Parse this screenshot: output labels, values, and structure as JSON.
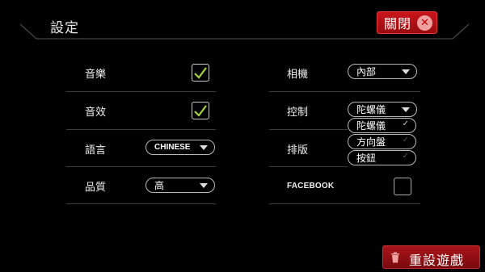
{
  "header": {
    "title": "設定",
    "close_label": "關閉"
  },
  "left": {
    "music_label": "音樂",
    "sfx_label": "音效",
    "language_label": "語言",
    "language_value": "CHINESE",
    "quality_label": "品質",
    "quality_value": "高"
  },
  "right": {
    "camera_label": "相機",
    "camera_value": "內部",
    "control_label": "控制",
    "control_value": "陀螺儀",
    "control_options": [
      "陀螺儀",
      "方向盤",
      "按鈕"
    ],
    "layout_label": "排版",
    "facebook_label": "FACEBOOK"
  },
  "footer": {
    "reset_label": "重設遊戲"
  },
  "colors": {
    "accent_red": "#c8141a",
    "check_green": "#a6d23c"
  }
}
